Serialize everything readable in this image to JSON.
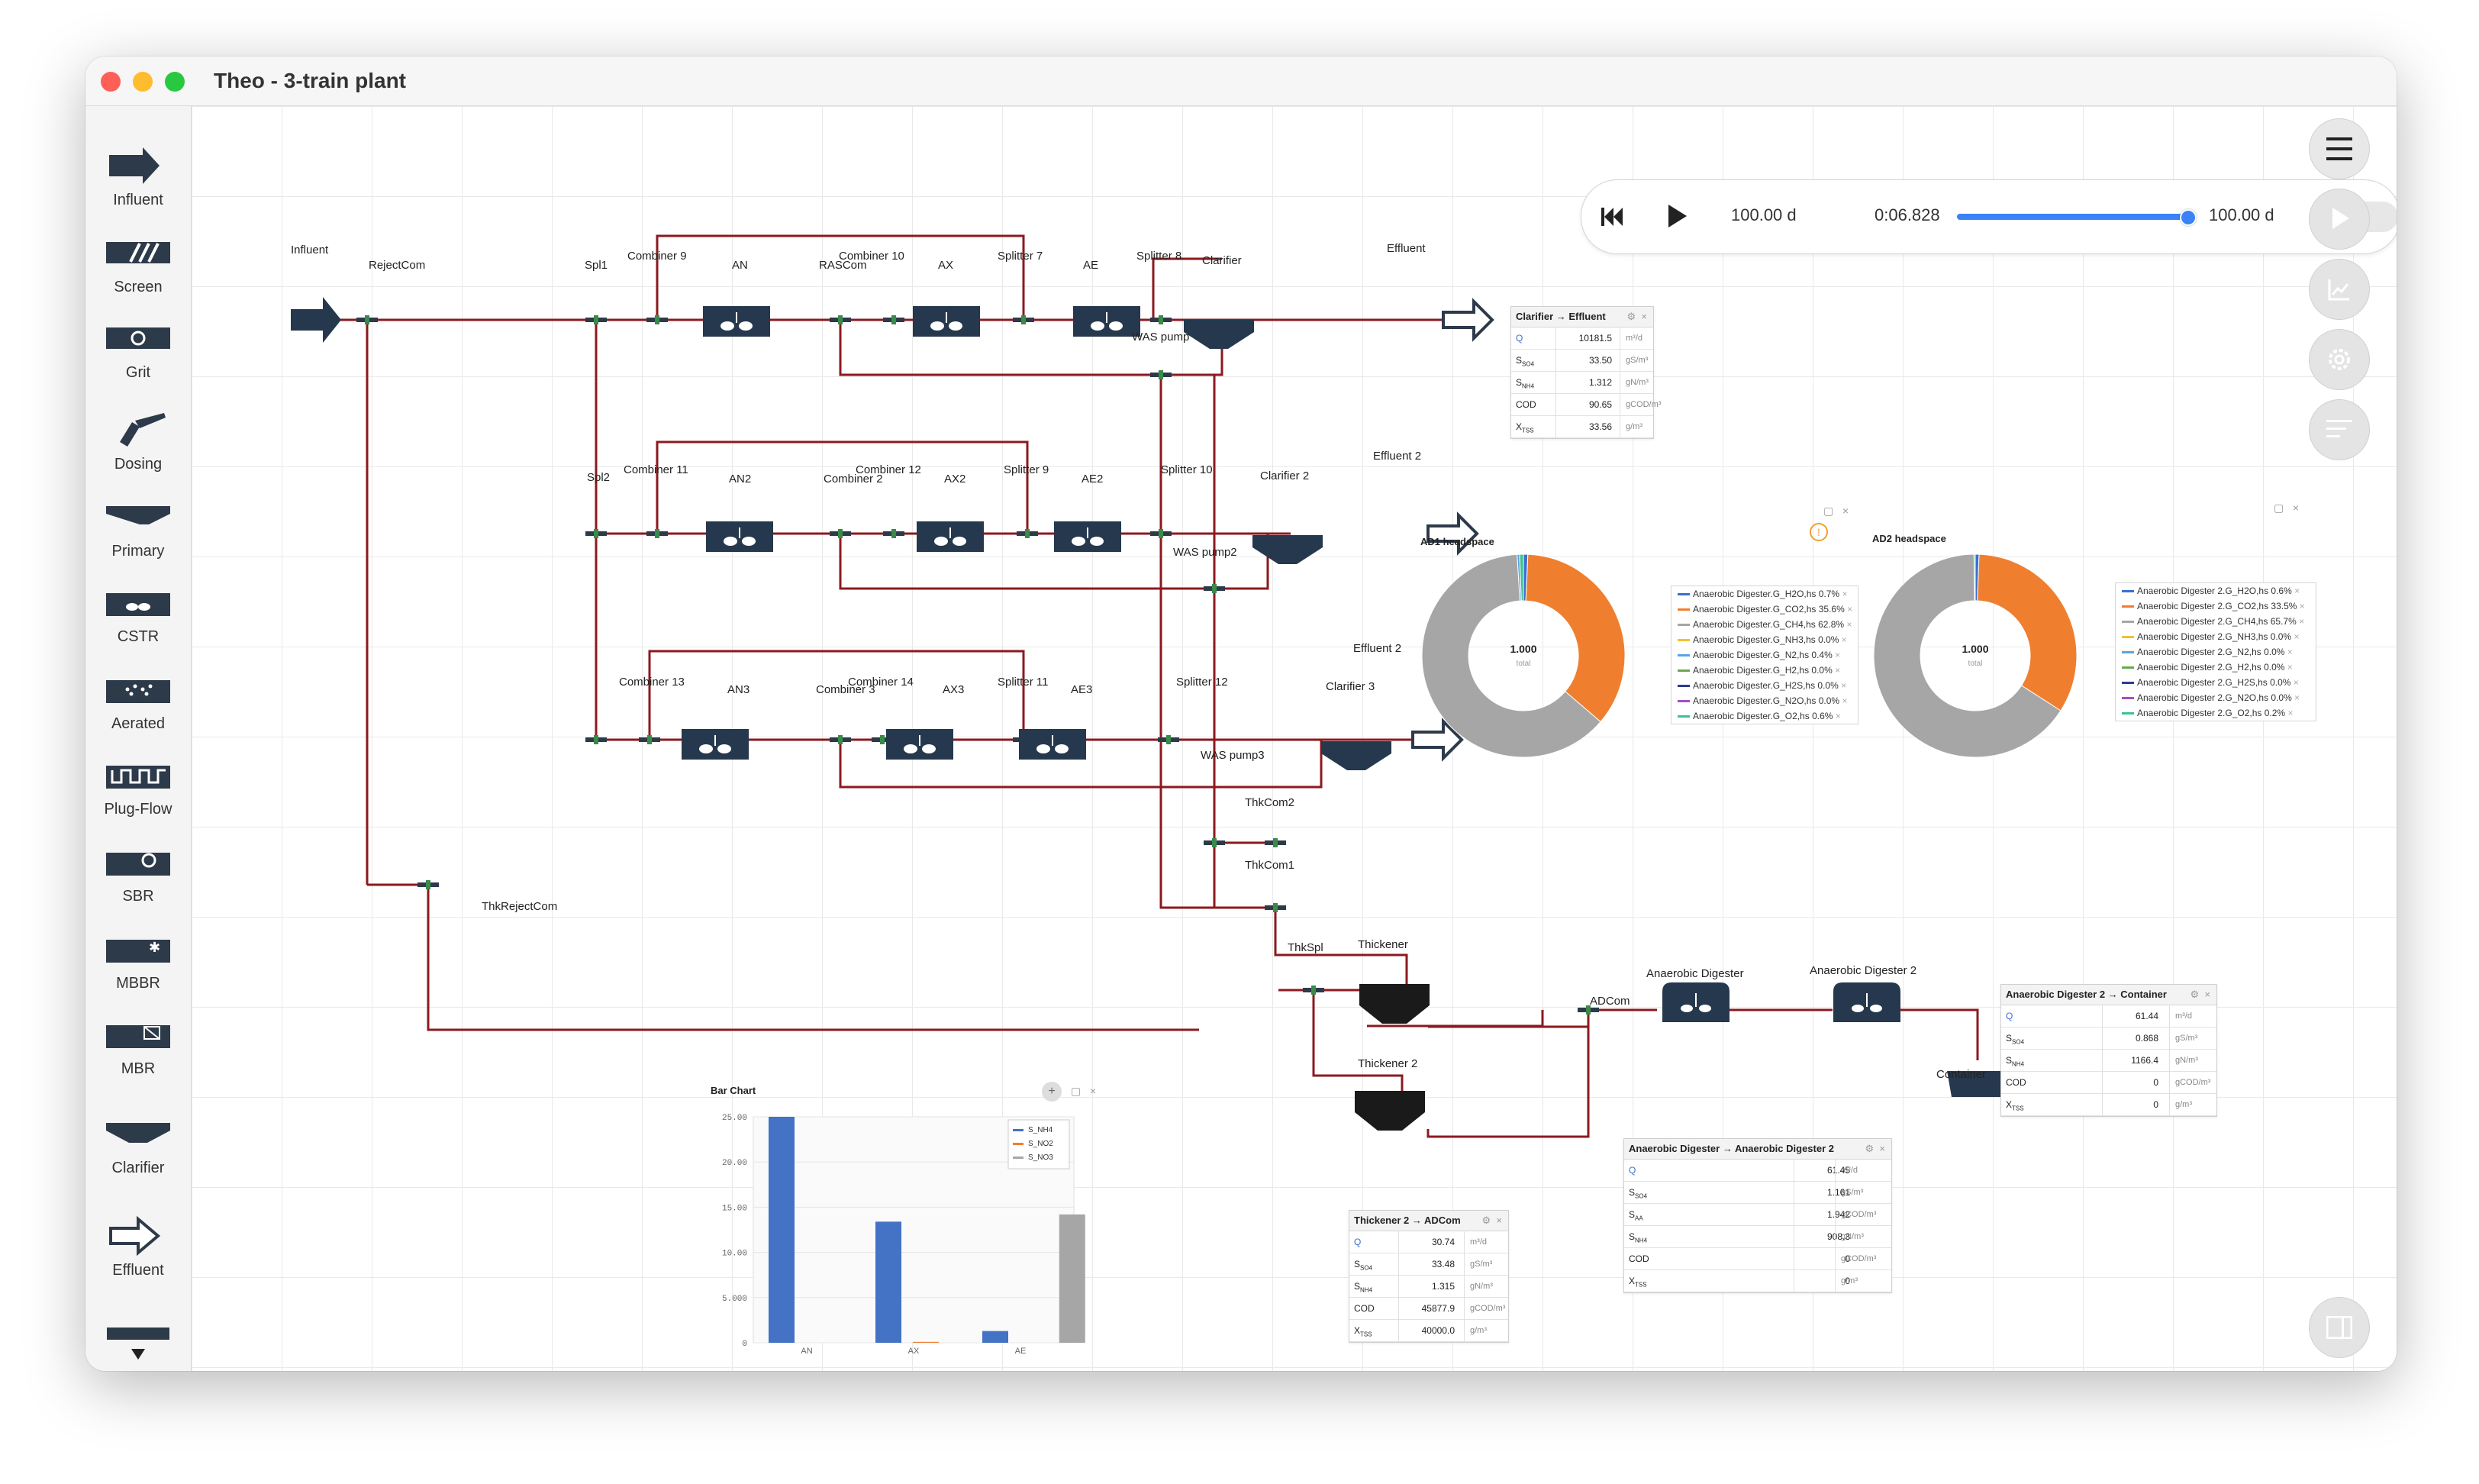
{
  "window": {
    "title": "Theo - 3-train plant",
    "traffic": [
      "#fe5f57",
      "#febc2e",
      "#28c840"
    ]
  },
  "sidebar": {
    "items": [
      {
        "label": "Influent",
        "icon": "influent-icon"
      },
      {
        "label": "Screen",
        "icon": "screen-icon"
      },
      {
        "label": "Grit",
        "icon": "grit-icon"
      },
      {
        "label": "Dosing",
        "icon": "dosing-icon"
      },
      {
        "label": "Primary",
        "icon": "primary-icon"
      },
      {
        "label": "CSTR",
        "icon": "cstr-icon"
      },
      {
        "label": "Aerated",
        "icon": "aerated-icon"
      },
      {
        "label": "Plug-Flow",
        "icon": "plug-flow-icon"
      },
      {
        "label": "SBR",
        "icon": "sbr-icon"
      },
      {
        "label": "MBBR",
        "icon": "mbbr-icon"
      },
      {
        "label": "MBR",
        "icon": "mbr-icon"
      },
      {
        "label": "Clarifier",
        "icon": "clarifier-icon"
      },
      {
        "label": "Effluent",
        "icon": "effluent-icon"
      }
    ]
  },
  "sim": {
    "start": "100.00 d",
    "elapsed": "0:06.828",
    "end": "100.00 d",
    "progress": 0.98,
    "accent": "#3b82f6"
  },
  "labels": {
    "influent": "Influent",
    "rejectcom": "RejectCom",
    "spl1": "Spl1",
    "combiner9": "Combiner 9",
    "an": "AN",
    "rascom": "RASCom",
    "combiner10": "Combiner 10",
    "ax": "AX",
    "splitter7": "Splitter 7",
    "ae": "AE",
    "splitter8": "Splitter 8",
    "clarifier": "Clarifier",
    "waspump": "WAS pump",
    "effluent": "Effluent",
    "spl2": "Spl2",
    "combiner11": "Combiner 11",
    "an2": "AN2",
    "combiner2": "Combiner 2",
    "combiner12": "Combiner 12",
    "ax2": "AX2",
    "splitter9": "Splitter 9",
    "ae2": "AE2",
    "splitter10": "Splitter 10",
    "clarifier2": "Clarifier 2",
    "waspump2": "WAS pump2",
    "effluent2": "Effluent 2",
    "combiner13": "Combiner 13",
    "an3": "AN3",
    "combiner3": "Combiner 3",
    "combiner14": "Combiner 14",
    "ax3": "AX3",
    "splitter11": "Splitter 11",
    "ae3": "AE3",
    "splitter12": "Splitter 12",
    "clarifier3": "Clarifier 3",
    "waspump3": "WAS pump3",
    "effluent2b": "Effluent 2",
    "thkcom2": "ThkCom2",
    "thkcom1": "ThkCom1",
    "thkrejectcom": "ThkRejectCom",
    "thkspl": "ThkSpl",
    "thickener": "Thickener",
    "thickener2": "Thickener 2",
    "adcom": "ADCom",
    "ad1": "Anaerobic Digester",
    "ad2": "Anaerobic Digester 2",
    "container": "Container"
  },
  "tables": {
    "clarifier_effluent": {
      "title": "Clarifier → Effluent",
      "rows": [
        [
          "Q",
          "10181.5",
          "m³/d"
        ],
        [
          "S_SO4",
          "33.50",
          "gS/m³"
        ],
        [
          "S_NH4",
          "1.312",
          "gN/m³"
        ],
        [
          "COD",
          "90.65",
          "gCOD/m³"
        ],
        [
          "X_TSS",
          "33.56",
          "g/m³"
        ]
      ]
    },
    "thickener2_adcom": {
      "title": "Thickener 2 → ADCom",
      "rows": [
        [
          "Q",
          "30.74",
          "m³/d"
        ],
        [
          "S_SO4",
          "33.48",
          "gS/m³"
        ],
        [
          "S_NH4",
          "1.315",
          "gN/m³"
        ],
        [
          "COD",
          "45877.9",
          "gCOD/m³"
        ],
        [
          "X_TSS",
          "40000.0",
          "g/m³"
        ]
      ]
    },
    "ad_ad2": {
      "title": "Anaerobic Digester → Anaerobic Digester 2",
      "rows": [
        [
          "Q",
          "61.45",
          "m³/d"
        ],
        [
          "S_SO4",
          "1.161",
          "gS/m³"
        ],
        [
          "S_AA",
          "1.942",
          "gCOD/m³"
        ],
        [
          "S_NH4",
          "908.3",
          "gN/m³"
        ],
        [
          "COD",
          "0",
          "gCOD/m³"
        ],
        [
          "X_TSS",
          "0",
          "g/m³"
        ]
      ]
    },
    "ad2_container": {
      "title": "Anaerobic Digester 2 → Container",
      "rows": [
        [
          "Q",
          "61.44",
          "m³/d"
        ],
        [
          "S_SO4",
          "0.868",
          "gS/m³"
        ],
        [
          "S_NH4",
          "1166.4",
          "gN/m³"
        ],
        [
          "COD",
          "0",
          "gCOD/m³"
        ],
        [
          "X_TSS",
          "0",
          "g/m³"
        ]
      ]
    }
  },
  "pies": {
    "ad1": {
      "title": "AD1 headspace",
      "center": "1.000",
      "sub": "total",
      "slices": [
        0.7,
        35.6,
        62.8,
        0.0,
        0.4,
        0.0,
        0.0,
        0.0,
        0.6
      ],
      "legend": [
        "Anaerobic Digester.G_H2O,hs 0.7%",
        "Anaerobic Digester.G_CO2,hs 35.6%",
        "Anaerobic Digester.G_CH4,hs 62.8%",
        "Anaerobic Digester.G_NH3,hs 0.0%",
        "Anaerobic Digester.G_N2,hs 0.4%",
        "Anaerobic Digester.G_H2,hs 0.0%",
        "Anaerobic Digester.G_H2S,hs 0.0%",
        "Anaerobic Digester.G_N2O,hs 0.0%",
        "Anaerobic Digester.G_O2,hs 0.6%"
      ]
    },
    "ad2": {
      "title": "AD2 headspace",
      "center": "1.000",
      "sub": "total",
      "slices": [
        0.6,
        33.5,
        65.7,
        0.0,
        0.0,
        0.0,
        0.0,
        0.0,
        0.2
      ],
      "legend": [
        "Anaerobic Digester 2.G_H2O,hs 0.6%",
        "Anaerobic Digester 2.G_CO2,hs 33.5%",
        "Anaerobic Digester 2.G_CH4,hs 65.7%",
        "Anaerobic Digester 2.G_NH3,hs 0.0%",
        "Anaerobic Digester 2.G_N2,hs 0.0%",
        "Anaerobic Digester 2.G_H2,hs 0.0%",
        "Anaerobic Digester 2.G_H2S,hs 0.0%",
        "Anaerobic Digester 2.G_N2O,hs 0.0%",
        "Anaerobic Digester 2.G_O2,hs 0.2%"
      ]
    },
    "colors": [
      "#3b6fd1",
      "#ef7f2f",
      "#a6a6a6",
      "#f2c12e",
      "#5aa5e0",
      "#6aa84f",
      "#2d3c8f",
      "#a34fc1",
      "#3cc28f"
    ]
  },
  "chart_data": {
    "type": "bar",
    "title": "Bar Chart",
    "categories": [
      "AN",
      "AX",
      "AE"
    ],
    "series": [
      {
        "name": "S_NH4",
        "values": [
          25.0,
          0.0,
          0.0
        ],
        "color": "#4472c4"
      },
      {
        "name": "S_NO2",
        "values": [
          0.0,
          0.1,
          0.0
        ],
        "color": "#ef7f2f"
      },
      {
        "name": "S_NO3",
        "values": [
          0.0,
          13.5,
          14.2
        ],
        "color": "#a6a6a6"
      }
    ],
    "extra": {
      "AX_blue": 13.4,
      "AE_blue": 1.3
    },
    "yticks": [
      "25.00",
      "20.00",
      "15.00",
      "10.00",
      "5.000",
      "0"
    ],
    "ylim": [
      0,
      25
    ]
  }
}
